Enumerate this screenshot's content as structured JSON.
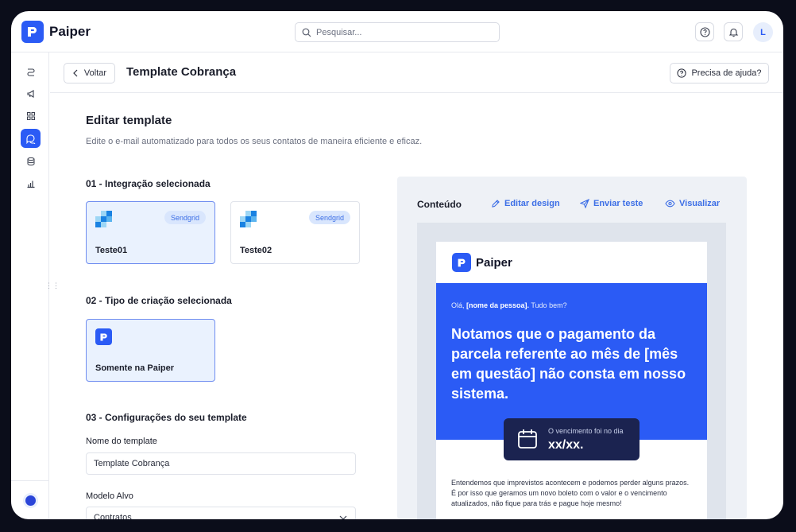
{
  "app": {
    "name": "Paiper"
  },
  "search": {
    "placeholder": "Pesquisar..."
  },
  "topbar": {
    "avatar_initial": "L",
    "help_icon": "help-circle-icon",
    "bell_icon": "bell-icon"
  },
  "sidebar": {
    "items": [
      {
        "icon": "route-icon"
      },
      {
        "icon": "megaphone-icon"
      },
      {
        "icon": "grid-icon"
      },
      {
        "icon": "chat-icon",
        "active": true
      },
      {
        "icon": "database-icon"
      },
      {
        "icon": "bar-chart-icon"
      }
    ]
  },
  "header": {
    "back_label": "Voltar",
    "title": "Template Cobrança",
    "help_label": "Precisa de ajuda?"
  },
  "editor": {
    "title": "Editar template",
    "subtitle": "Edite o e-mail automatizado para todos os seus contatos de maneira eficiente e eficaz.",
    "section1": {
      "title": "01 - Integração selecionada",
      "cards": [
        {
          "name": "Teste01",
          "badge": "Sendgrid",
          "selected": true
        },
        {
          "name": "Teste02",
          "badge": "Sendgrid",
          "selected": false
        }
      ]
    },
    "section2": {
      "title": "02 - Tipo de criação selecionada",
      "card": {
        "name": "Somente na Paiper",
        "selected": true
      }
    },
    "section3": {
      "title": "03 - Configurações do seu template",
      "name_label": "Nome do template",
      "name_value": "Template Cobrança",
      "model_label": "Modelo Alvo",
      "model_value": "Contratos"
    }
  },
  "preview": {
    "title": "Conteúdo",
    "edit_design": "Editar design",
    "send_test": "Enviar teste",
    "view": "Visualizar",
    "email": {
      "brand": "Paiper",
      "greeting_prefix": "Olá, ",
      "greeting_name": "[nome da pessoa].",
      "greeting_suffix": " Tudo bem?",
      "headline": "Notamos que o pagamento da parcela referente ao mês de [mês em questão] não consta em nosso sistema.",
      "due_label": "O vencimento foi no dia",
      "due_value": "xx/xx.",
      "body": "Entendemos que imprevistos acontecem e podemos perder alguns prazos. É por isso que geramos um novo boleto com o valor e o vencimento atualizados, não fique para trás e pague hoje mesmo!"
    }
  },
  "colors": {
    "accent": "#2b5bf5",
    "dark": "#1b2350",
    "selected_bg": "#eaf2fe"
  }
}
